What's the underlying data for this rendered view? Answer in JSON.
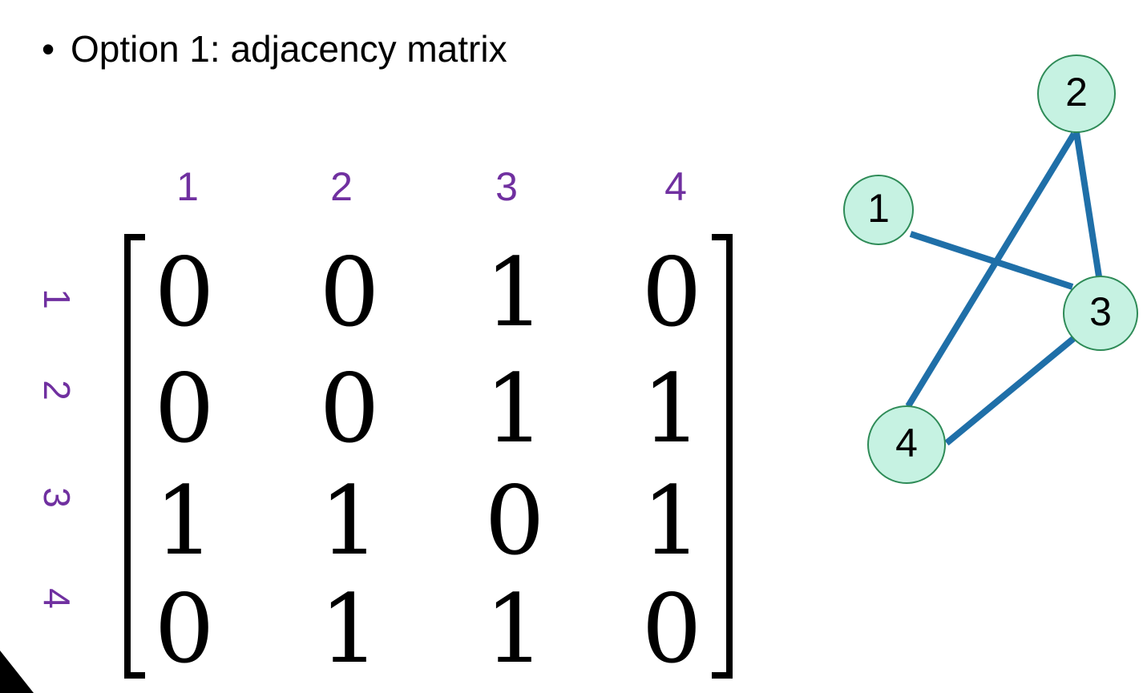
{
  "bullet": {
    "marker": "•",
    "text": "Option 1: adjacency matrix"
  },
  "matrix": {
    "column_labels": [
      "1",
      "2",
      "3",
      "4"
    ],
    "row_labels": [
      "1",
      "2",
      "3",
      "4"
    ],
    "rows": [
      [
        "0",
        "0",
        "1",
        "0"
      ],
      [
        "0",
        "0",
        "1",
        "1"
      ],
      [
        "1",
        "1",
        "0",
        "1"
      ],
      [
        "0",
        "1",
        "1",
        "0"
      ]
    ],
    "label_color": "#7030a0"
  },
  "graph": {
    "nodes": [
      "1",
      "2",
      "3",
      "4"
    ],
    "edges": [
      [
        "1",
        "3"
      ],
      [
        "2",
        "3"
      ],
      [
        "2",
        "4"
      ],
      [
        "3",
        "4"
      ]
    ],
    "node_fill": "#c6f2e2",
    "node_stroke": "#2e8b57",
    "edge_color": "#1f6fa8"
  }
}
